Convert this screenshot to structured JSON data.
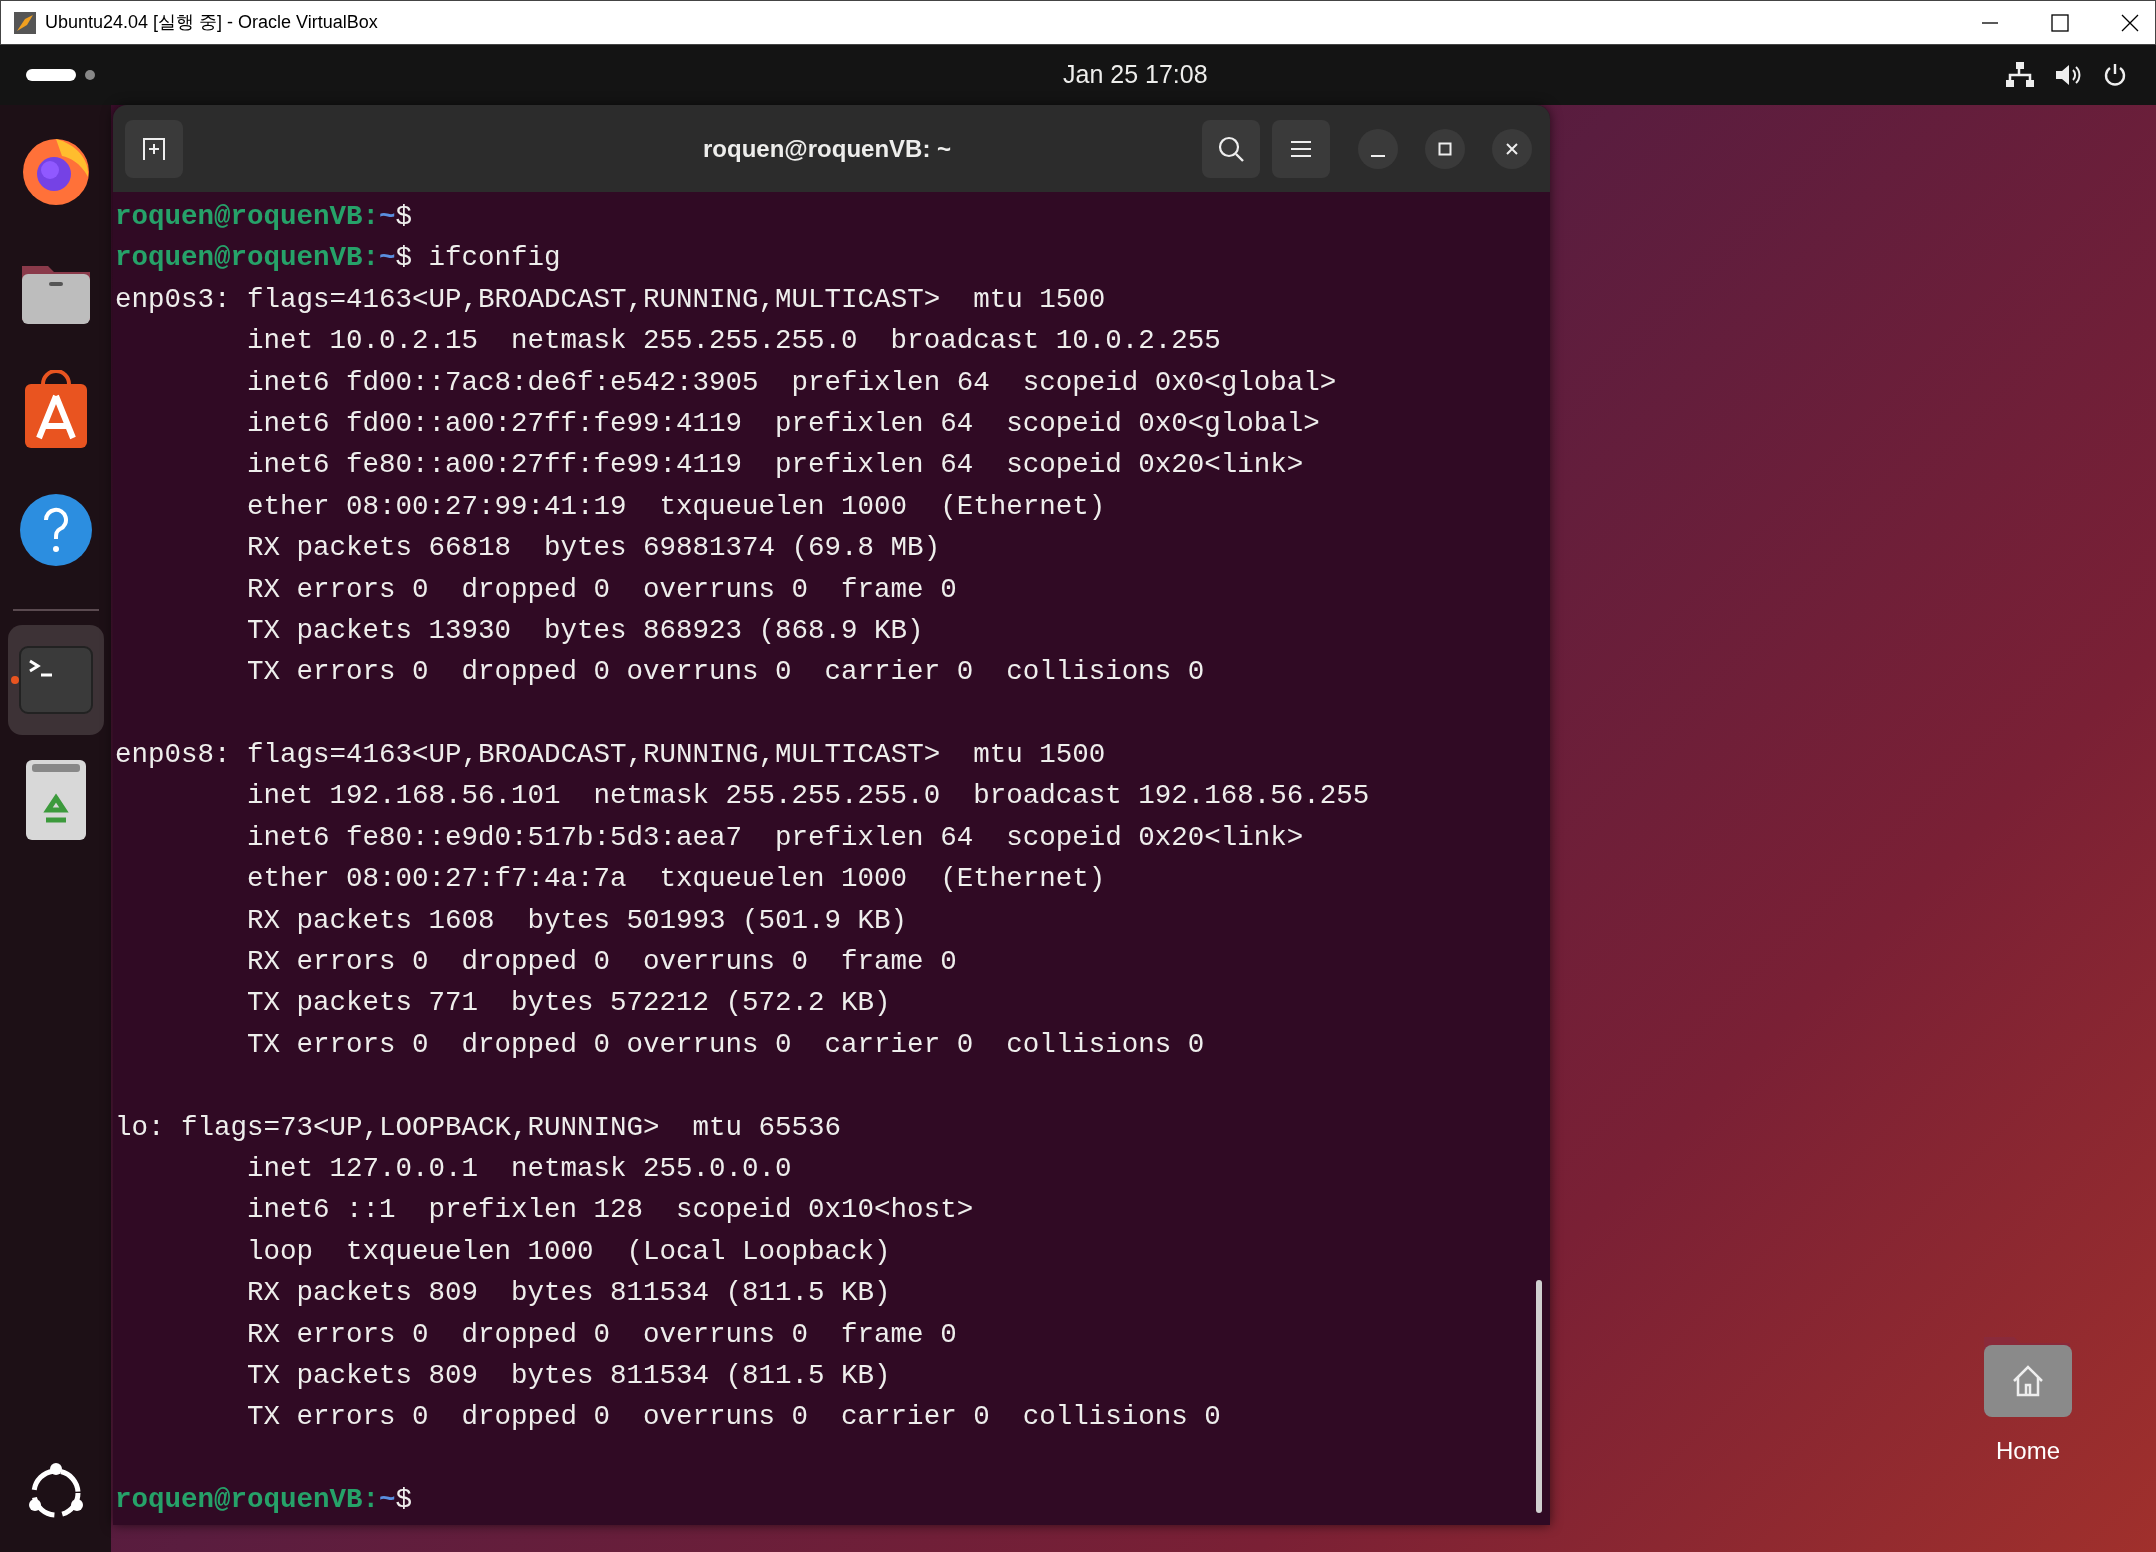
{
  "host_window": {
    "title": "Ubuntu24.04 [실행 중] - Oracle VirtualBox"
  },
  "top_bar": {
    "clock": "Jan 25  17:08"
  },
  "dock": {
    "items": [
      {
        "kind": "browser",
        "active": false
      },
      {
        "kind": "files",
        "active": false
      },
      {
        "kind": "store",
        "active": false
      },
      {
        "kind": "help",
        "active": false
      },
      {
        "kind": "separator"
      },
      {
        "kind": "terminal",
        "active": true
      },
      {
        "kind": "trash",
        "active": false
      }
    ]
  },
  "terminal": {
    "title": "roquen@roquenVB: ~",
    "lines": [
      {
        "kind": "prompt",
        "user": "roquen@roquenVB:",
        "path": "~",
        "symbol": "$"
      },
      {
        "kind": "prompt",
        "user": "roquen@roquenVB:",
        "path": "~",
        "symbol": "$",
        "command": "ifconfig"
      },
      {
        "kind": "header",
        "text": "enp0s3: flags=4163<UP,BROADCAST,RUNNING,MULTICAST>  mtu 1500"
      },
      {
        "kind": "detail",
        "text": "inet 10.0.2.15  netmask 255.255.255.0  broadcast 10.0.2.255"
      },
      {
        "kind": "detail",
        "text": "inet6 fd00::7ac8:de6f:e542:3905  prefixlen 64  scopeid 0x0<global>"
      },
      {
        "kind": "detail",
        "text": "inet6 fd00::a00:27ff:fe99:4119  prefixlen 64  scopeid 0x0<global>"
      },
      {
        "kind": "detail",
        "text": "inet6 fe80::a00:27ff:fe99:4119  prefixlen 64  scopeid 0x20<link>"
      },
      {
        "kind": "detail",
        "text": "ether 08:00:27:99:41:19  txqueuelen 1000  (Ethernet)"
      },
      {
        "kind": "detail",
        "text": "RX packets 66818  bytes 69881374 (69.8 MB)"
      },
      {
        "kind": "detail",
        "text": "RX errors 0  dropped 0  overruns 0  frame 0"
      },
      {
        "kind": "detail",
        "text": "TX packets 13930  bytes 868923 (868.9 KB)"
      },
      {
        "kind": "detail",
        "text": "TX errors 0  dropped 0 overruns 0  carrier 0  collisions 0"
      },
      {
        "kind": "blank"
      },
      {
        "kind": "header",
        "text": "enp0s8: flags=4163<UP,BROADCAST,RUNNING,MULTICAST>  mtu 1500"
      },
      {
        "kind": "detail",
        "text": "inet 192.168.56.101  netmask 255.255.255.0  broadcast 192.168.56.255"
      },
      {
        "kind": "detail",
        "text": "inet6 fe80::e9d0:517b:5d3:aea7  prefixlen 64  scopeid 0x20<link>"
      },
      {
        "kind": "detail",
        "text": "ether 08:00:27:f7:4a:7a  txqueuelen 1000  (Ethernet)"
      },
      {
        "kind": "detail",
        "text": "RX packets 1608  bytes 501993 (501.9 KB)"
      },
      {
        "kind": "detail",
        "text": "RX errors 0  dropped 0  overruns 0  frame 0"
      },
      {
        "kind": "detail",
        "text": "TX packets 771  bytes 572212 (572.2 KB)"
      },
      {
        "kind": "detail",
        "text": "TX errors 0  dropped 0 overruns 0  carrier 0  collisions 0"
      },
      {
        "kind": "blank"
      },
      {
        "kind": "header",
        "text": "lo: flags=73<UP,LOOPBACK,RUNNING>  mtu 65536"
      },
      {
        "kind": "detail",
        "text": "inet 127.0.0.1  netmask 255.0.0.0"
      },
      {
        "kind": "detail",
        "text": "inet6 ::1  prefixlen 128  scopeid 0x10<host>"
      },
      {
        "kind": "detail",
        "text": "loop  txqueuelen 1000  (Local Loopback)"
      },
      {
        "kind": "detail",
        "text": "RX packets 809  bytes 811534 (811.5 KB)"
      },
      {
        "kind": "detail",
        "text": "RX errors 0  dropped 0  overruns 0  frame 0"
      },
      {
        "kind": "detail",
        "text": "TX packets 809  bytes 811534 (811.5 KB)"
      },
      {
        "kind": "detail",
        "text": "TX errors 0  dropped 0  overruns 0  carrier 0  collisions 0"
      },
      {
        "kind": "blank"
      },
      {
        "kind": "prompt",
        "user": "roquen@roquenVB:",
        "path": "~",
        "symbol": "$"
      }
    ]
  },
  "desktop": {
    "home_folder": {
      "label": "Home"
    }
  }
}
